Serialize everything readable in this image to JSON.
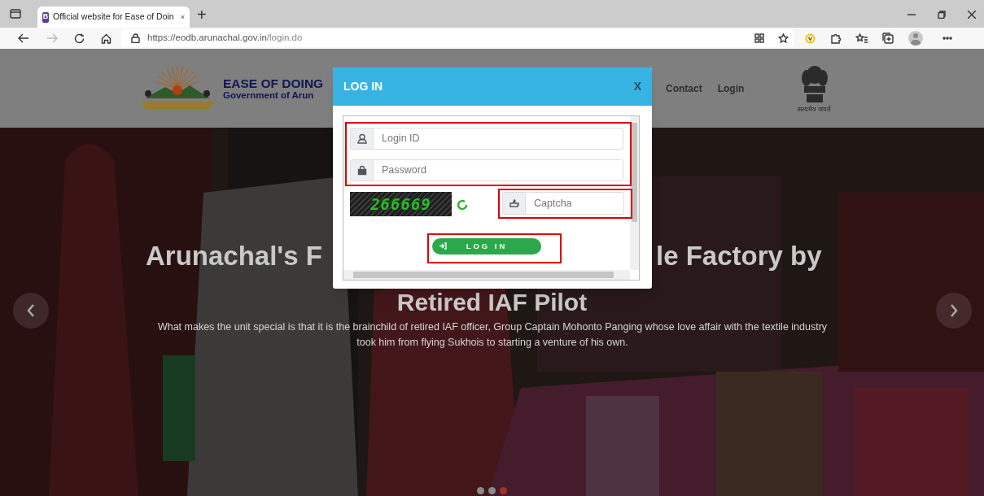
{
  "browser": {
    "tabs": [
      {
        "title": "Official website for Ease of Doin",
        "favicon": "B",
        "selected": true
      }
    ],
    "new_tab": "+",
    "url_host": "https://eodb.arunachal.gov.in",
    "url_path": "/login.do"
  },
  "header": {
    "title": "EASE OF DOING",
    "subtitle": "Government of Arun",
    "nav": [
      {
        "label": "Contact"
      },
      {
        "label": "Login"
      }
    ],
    "emblem_motto": "सत्यमेव जयते"
  },
  "hero": {
    "headline_left": "Arunachal's F",
    "headline_right": "le Factory by",
    "headline_line2": "Retired IAF Pilot",
    "description": "What makes the unit special is that it is the brainchild of retired IAF officer, Group Captain Mohonto Panging whose love affair with the textile industry took him from flying Sukhois to starting a venture of his own.",
    "dots": [
      {
        "selected": false
      },
      {
        "selected": false
      },
      {
        "selected": true
      }
    ]
  },
  "modal": {
    "title": "LOG IN",
    "close": "X",
    "fields": [
      {
        "kind": "user",
        "placeholder": "Login ID"
      },
      {
        "kind": "lock",
        "placeholder": "Password"
      }
    ],
    "captcha_code": "266669",
    "captcha_field": {
      "placeholder": "Captcha"
    },
    "submit": "LOG IN"
  }
}
